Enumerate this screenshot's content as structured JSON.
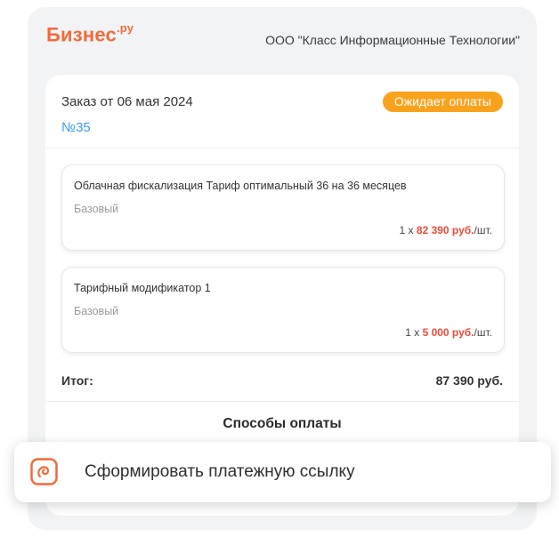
{
  "header": {
    "logo_text": "Бизнес",
    "logo_suffix": ".ру",
    "company": "ООО \"Класс Информационные Технологии\""
  },
  "order": {
    "title": "Заказ от 06 мая 2024",
    "number": "№35",
    "status": "Ожидает оплаты"
  },
  "items": [
    {
      "name": "Облачная фискализация  Тариф оптимальный 36 на 36 месяцев",
      "tariff": "Базовый",
      "qty": "1 x ",
      "price": "82 390 руб.",
      "unit": "/шт."
    },
    {
      "name": "Тарифный модификатор 1",
      "tariff": "Базовый",
      "qty": "1 x ",
      "price": "5 000 руб.",
      "unit": "/шт."
    }
  ],
  "total": {
    "label": "Итог:",
    "value": "87 390 руб."
  },
  "payment": {
    "title": "Способы оплаты",
    "link_label": "Сформировать платежную ссылку"
  },
  "colors": {
    "accent": "#f26a3b",
    "status_badge": "#f9a21b",
    "link": "#3b9bea",
    "price": "#ee4b3a"
  },
  "icons": {
    "link_button": "payment-link-icon"
  }
}
